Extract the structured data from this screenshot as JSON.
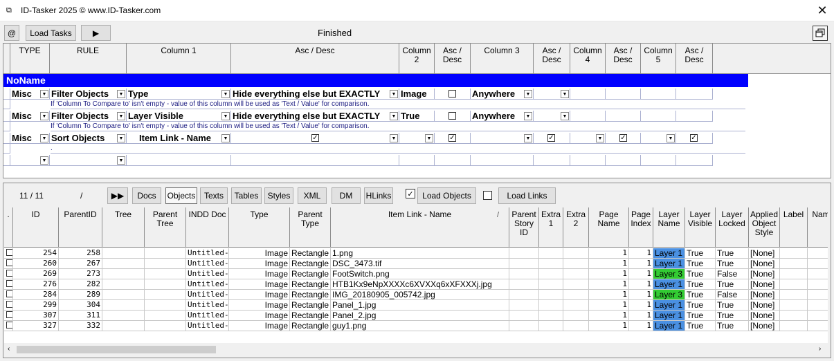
{
  "window": {
    "title": "ID-Tasker 2025  © www.ID-Tasker.com"
  },
  "toolbar": {
    "at_label": "@",
    "load_tasks_label": "Load Tasks",
    "run_label": "▶",
    "status": "Finished"
  },
  "tasks": {
    "headers": [
      "TYPE",
      "RULE",
      "Column 1",
      "Asc / Desc",
      "Column\n2",
      "Asc /\nDesc",
      "Column 3",
      "Asc /\nDesc",
      "Column\n4",
      "Asc /\nDesc",
      "Column\n5",
      "Asc /\nDesc"
    ],
    "group_name": "NoName",
    "rows": [
      {
        "type": "Misc",
        "rule": "Filter Objects",
        "col1": "Type",
        "ascdesc": "Hide everything else but EXACTLY",
        "col2": "Image",
        "col3": "Anywhere",
        "hint": "If 'Column To Compare to' isn't empty - value of this column will be used as 'Text / Value' for comparison."
      },
      {
        "type": "Misc",
        "rule": "Filter Objects",
        "col1": "Layer Visible",
        "ascdesc": "Hide everything else but EXACTLY",
        "col2": "True",
        "col3": "Anywhere",
        "hint": "If 'Column To Compare to' isn't empty - value of this column will be used as 'Text / Value' for comparison."
      },
      {
        "type": "Misc",
        "rule": "Sort Objects",
        "col1": "Item Link - Name",
        "hint": "."
      }
    ]
  },
  "objects_panel": {
    "count": "11 / 11",
    "slash": "/",
    "skip_label": "▶▶",
    "tabs": [
      "Docs",
      "Objects",
      "Texts",
      "Tables",
      "Styles",
      "XML",
      "DM",
      "HLinks"
    ],
    "selected_tab": "Objects",
    "load_objects_label": "Load Objects",
    "load_links_label": "Load Links"
  },
  "objects_table": {
    "headers": [
      ".",
      "ID",
      "ParentID",
      "Tree",
      "Parent\nTree",
      "INDD Doc",
      "Type",
      "Parent\nType",
      "Item Link - Name",
      "Parent\nStory\nID",
      "Extra\n1",
      "Extra\n2",
      "Page\nName",
      "Page\nIndex",
      "Layer\nName",
      "Layer\nVisible",
      "Layer\nLocked",
      "Applied\nObject\nStyle",
      "Label",
      "Nam"
    ],
    "sort_marker": "/",
    "rows": [
      {
        "id": "254",
        "parent": "258",
        "doc": "Untitled-1",
        "type": "Image",
        "ptype": "Rectangle",
        "name": "1.png",
        "page": "1",
        "index": "1",
        "layer": "Layer 1",
        "visible": "True",
        "locked": "True",
        "style": "[None]"
      },
      {
        "id": "260",
        "parent": "267",
        "doc": "Untitled-1",
        "type": "Image",
        "ptype": "Rectangle",
        "name": "DSC_3473.tif",
        "page": "1",
        "index": "1",
        "layer": "Layer 1",
        "visible": "True",
        "locked": "True",
        "style": "[None]"
      },
      {
        "id": "269",
        "parent": "273",
        "doc": "Untitled-1",
        "type": "Image",
        "ptype": "Rectangle",
        "name": "FootSwitch.png",
        "page": "1",
        "index": "1",
        "layer": "Layer 3",
        "visible": "True",
        "locked": "False",
        "style": "[None]"
      },
      {
        "id": "276",
        "parent": "282",
        "doc": "Untitled-1",
        "type": "Image",
        "ptype": "Rectangle",
        "name": "HTB1Kx9eNpXXXXc6XVXXq6xXFXXXj.jpg",
        "page": "1",
        "index": "1",
        "layer": "Layer 1",
        "visible": "True",
        "locked": "True",
        "style": "[None]"
      },
      {
        "id": "284",
        "parent": "289",
        "doc": "Untitled-1",
        "type": "Image",
        "ptype": "Rectangle",
        "name": "IMG_20180905_005742.jpg",
        "page": "1",
        "index": "1",
        "layer": "Layer 3",
        "visible": "True",
        "locked": "False",
        "style": "[None]"
      },
      {
        "id": "299",
        "parent": "304",
        "doc": "Untitled-1",
        "type": "Image",
        "ptype": "Rectangle",
        "name": "Panel_1.jpg",
        "page": "1",
        "index": "1",
        "layer": "Layer 1",
        "visible": "True",
        "locked": "True",
        "style": "[None]"
      },
      {
        "id": "307",
        "parent": "311",
        "doc": "Untitled-1",
        "type": "Image",
        "ptype": "Rectangle",
        "name": "Panel_2.jpg",
        "page": "1",
        "index": "1",
        "layer": "Layer 1",
        "visible": "True",
        "locked": "True",
        "style": "[None]"
      },
      {
        "id": "327",
        "parent": "332",
        "doc": "Untitled-1",
        "type": "Image",
        "ptype": "Rectangle",
        "name": "guy1.png",
        "page": "1",
        "index": "1",
        "layer": "Layer 1",
        "visible": "True",
        "locked": "True",
        "style": "[None]"
      }
    ]
  },
  "colors": {
    "group_bar": "#0000ff",
    "layer_1": "#4a90e2",
    "layer_3": "#33cc33"
  }
}
